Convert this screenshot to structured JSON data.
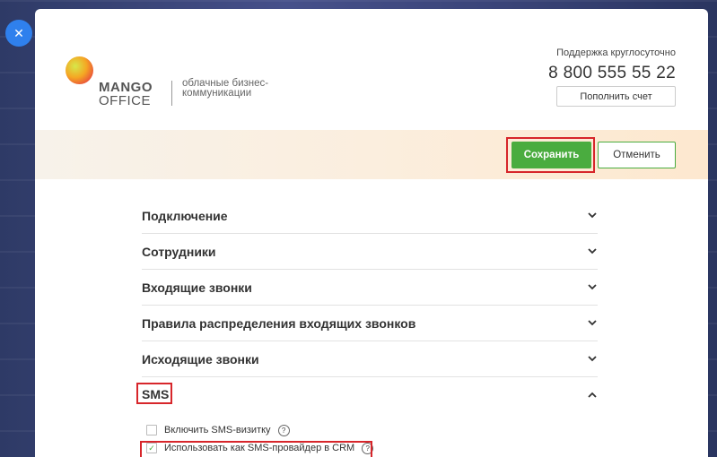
{
  "close": {
    "icon": "close-icon",
    "glyph": "✕"
  },
  "brand": {
    "line1": "MANGO",
    "line2": "OFFICE",
    "tagline": "облачные бизнес-коммуникации"
  },
  "support": {
    "label": "Поддержка круглосуточно",
    "phone": "8 800 555 55 22",
    "topup_label": "Пополнить счет"
  },
  "toolbar": {
    "save_label": "Сохранить",
    "cancel_label": "Отменить"
  },
  "sections": [
    {
      "label": "Подключение",
      "expanded": false
    },
    {
      "label": "Сотрудники",
      "expanded": false
    },
    {
      "label": "Входящие звонки",
      "expanded": false
    },
    {
      "label": "Правила распределения входящих звонков",
      "expanded": false
    },
    {
      "label": "Исходящие звонки",
      "expanded": false
    },
    {
      "label": "SMS",
      "expanded": true
    }
  ],
  "sms_options": [
    {
      "label": "Включить SMS-визитку",
      "checked": false
    },
    {
      "label": "Использовать как SMS-провайдер в CRM",
      "checked": true
    }
  ],
  "colors": {
    "accent_green": "#4aac3f",
    "highlight_red": "#d7262b",
    "close_blue": "#2f80ed"
  }
}
